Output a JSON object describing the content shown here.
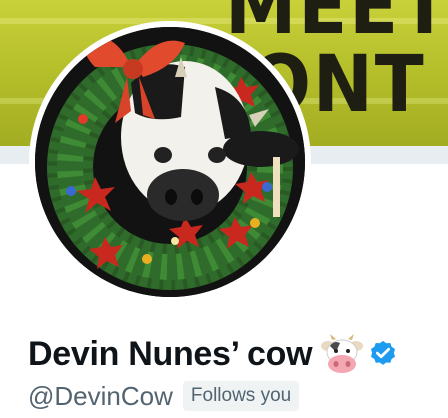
{
  "banner": {
    "line1": "MEET",
    "line2": "ONT"
  },
  "profile": {
    "display_name": "Devin Nunes’ cow",
    "name_emoji": "cow-face-emoji",
    "verified_icon": "verified-badge-icon",
    "handle": "@DevinCow",
    "follows_you_label": "Follows you"
  },
  "avatar": {
    "description_icon": "cow-with-christmas-wreath-avatar"
  },
  "colors": {
    "banner": "#b8c22c",
    "verified": "#1d9bf0",
    "handle": "#536471",
    "name": "#0f1419",
    "badge_bg": "#eff3f4"
  }
}
